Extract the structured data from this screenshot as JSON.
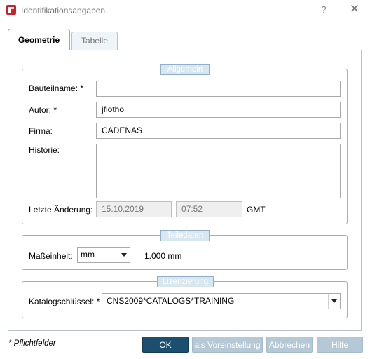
{
  "window": {
    "title": "Identifikationsangaben",
    "help_label": "?",
    "close_label": "✕"
  },
  "tabs": [
    {
      "label": "Geometrie",
      "active": true
    },
    {
      "label": "Tabelle",
      "active": false
    }
  ],
  "general": {
    "title": "Allgemein",
    "part_name": {
      "label": "Bauteilname: *",
      "value": ""
    },
    "author": {
      "label": "Autor: *",
      "value": "jflotho"
    },
    "company": {
      "label": "Firma:",
      "value": "CADENAS"
    },
    "history": {
      "label": "Historie:",
      "value": ""
    },
    "last_change": {
      "label": "Letzte Änderung:",
      "date": "15.10.2019",
      "time": "07:52",
      "timezone": "GMT"
    }
  },
  "part_data": {
    "title": "Teiledaten",
    "unit_label": "Maßeinheit:",
    "unit_value": "mm",
    "equals": "=",
    "conversion": "1.000 mm"
  },
  "licensing": {
    "title": "Lizenzierung",
    "catalog_key_label": "Katalogschlüssel: *",
    "catalog_key_value": "CNS2009*CATALOGS*TRAINING"
  },
  "footer": {
    "required_note": "* Pflichtfelder",
    "ok": "OK",
    "set_default": "als Voreinstellung",
    "cancel": "Abbrechen",
    "help": "Hilfe"
  },
  "colors": {
    "primary_button": "#1c4f6f",
    "disabled_button": "#b5c8d6",
    "group_title_bg": "#d8e6f0"
  }
}
